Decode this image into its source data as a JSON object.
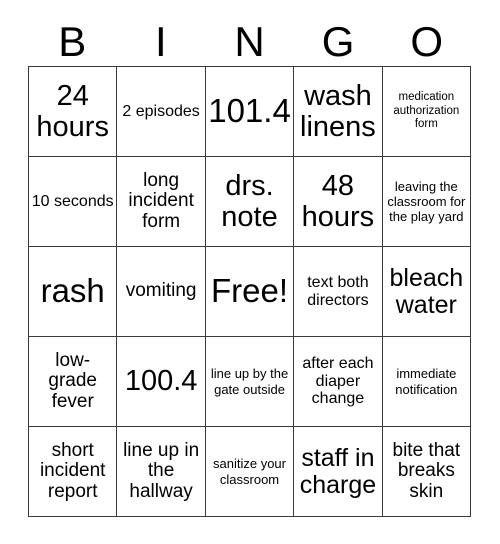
{
  "card": {
    "title": "BINGO",
    "header_letters": [
      "B",
      "I",
      "N",
      "G",
      "O"
    ],
    "free_space_label": "Free!",
    "colors": {
      "background": "#ffffff",
      "cell_background": "#ffffff",
      "border": "#3a3a3a",
      "text": "#000000"
    },
    "grid_size": "5x5",
    "rows": [
      [
        {
          "text": "24 hours",
          "size": "lg"
        },
        {
          "text": "2 episodes",
          "size": "xs"
        },
        {
          "text": "101.4",
          "size": "xl"
        },
        {
          "text": "wash linens",
          "size": "lg"
        },
        {
          "text": "medication authorization form",
          "size": "tiny"
        }
      ],
      [
        {
          "text": "10 seconds",
          "size": "xs"
        },
        {
          "text": "long incident form",
          "size": "sm"
        },
        {
          "text": "drs. note",
          "size": "lg"
        },
        {
          "text": "48 hours",
          "size": "lg"
        },
        {
          "text": "leaving the classroom for the play yard",
          "size": "xxs"
        }
      ],
      [
        {
          "text": "rash",
          "size": "xl"
        },
        {
          "text": "vomiting",
          "size": "sm"
        },
        {
          "text": "Free!",
          "size": "xl"
        },
        {
          "text": "text both directors",
          "size": "xs"
        },
        {
          "text": "bleach water",
          "size": "md"
        }
      ],
      [
        {
          "text": "low-grade fever",
          "size": "sm"
        },
        {
          "text": "100.4",
          "size": "lg"
        },
        {
          "text": "line up by the gate outside",
          "size": "xxs"
        },
        {
          "text": "after each diaper change",
          "size": "xs"
        },
        {
          "text": "immediate notification",
          "size": "xxs"
        }
      ],
      [
        {
          "text": "short incident report",
          "size": "sm"
        },
        {
          "text": "line up in the hallway",
          "size": "sm"
        },
        {
          "text": "sanitize your classroom",
          "size": "xxs"
        },
        {
          "text": "staff in charge",
          "size": "md"
        },
        {
          "text": "bite that breaks skin",
          "size": "sm"
        }
      ]
    ]
  }
}
